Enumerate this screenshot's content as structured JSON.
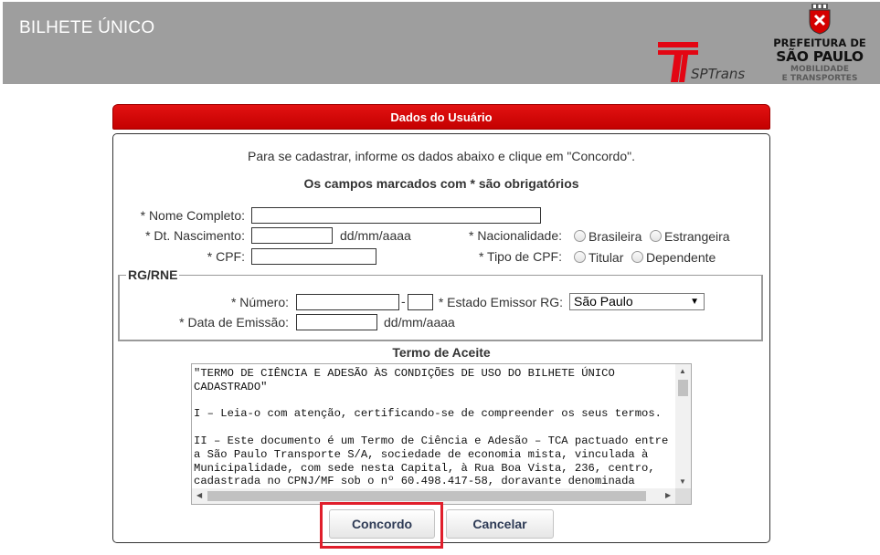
{
  "header": {
    "app_title": "BILHETE ÚNICO",
    "sptrans_logo_text": "SPTrans",
    "prefeitura_line1": "PREFEITURA DE",
    "prefeitura_line2": "SÃO PAULO",
    "prefeitura_line3a": "MOBILIDADE",
    "prefeitura_line3b": "E TRANSPORTES"
  },
  "panel": {
    "title": "Dados do Usuário",
    "intro": "Para se cadastrar, informe os dados abaixo e clique em \"Concordo\".",
    "required_note": "Os campos marcados com * são obrigatórios"
  },
  "form": {
    "nome_label": "* Nome Completo:",
    "nome_value": "",
    "nascimento_label": "* Dt. Nascimento:",
    "nascimento_value": "",
    "nascimento_hint": "dd/mm/aaaa",
    "nacionalidade_label": "* Nacionalidade:",
    "nacionalidade_options": [
      "Brasileira",
      "Estrangeira"
    ],
    "cpf_label": "* CPF:",
    "cpf_value": "",
    "tipo_cpf_label": "* Tipo de CPF:",
    "tipo_cpf_options": [
      "Titular",
      "Dependente"
    ],
    "rg": {
      "legend": "RG/RNE",
      "numero_label": "* Número:",
      "numero_value": "",
      "digito_separator": "-",
      "digito_value": "",
      "estado_label": "* Estado Emissor RG:",
      "estado_selected": "São Paulo",
      "emissao_label": "* Data de Emissão:",
      "emissao_value": "",
      "emissao_hint": "dd/mm/aaaa"
    }
  },
  "terms": {
    "title": "Termo de Aceite",
    "text": "\"TERMO DE CIÊNCIA E ADESÃO ÀS CONDIÇÕES DE USO DO BILHETE ÚNICO\nCADASTRADO\"\n\nI – Leia-o com atenção, certificando-se de compreender os seus termos.\n\nII – Este documento é um Termo de Ciência e Adesão – TCA pactuado entre\na São Paulo Transporte S/A, sociedade de economia mista, vinculada à\nMunicipalidade, com sede nesta Capital, à Rua Boa Vista, 236, centro,\ncadastrada no CPNJ/MF sob o nº 60.498.417-58, doravante denominada"
  },
  "buttons": {
    "concordo": "Concordo",
    "cancelar": "Cancelar"
  },
  "colors": {
    "header_bar": "#9e9e9e",
    "panel_red": "#d10000",
    "highlight": "#e01e2b"
  }
}
